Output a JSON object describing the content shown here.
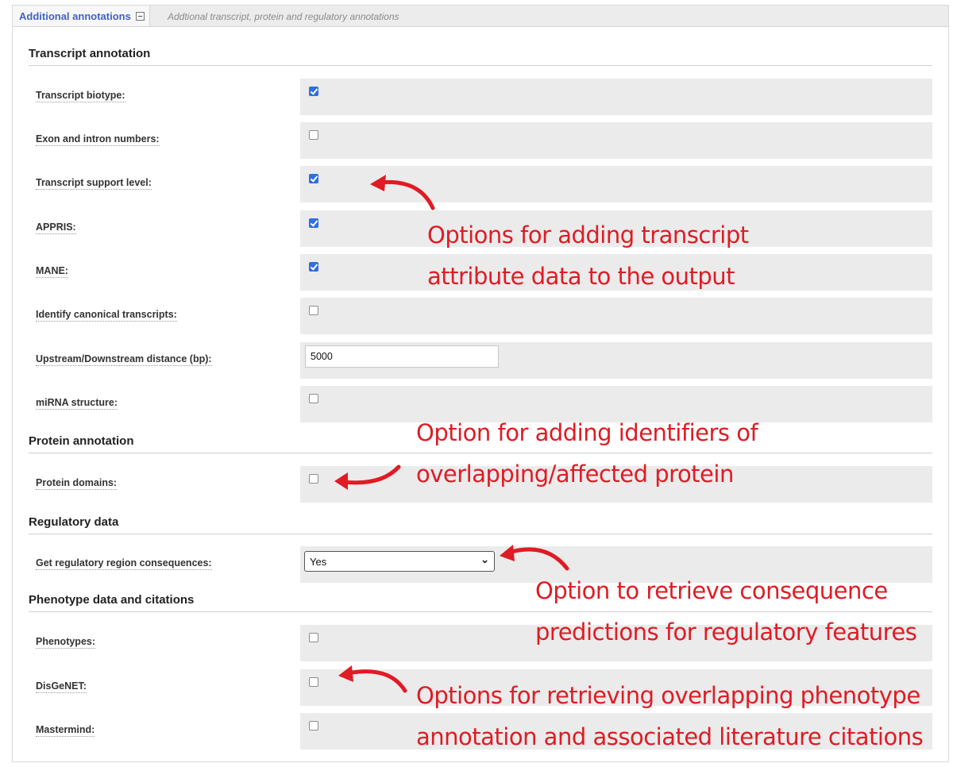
{
  "tab": {
    "title": "Additional annotations",
    "description": "Addtional transcript, protein and regulatory annotations"
  },
  "sections": {
    "transcript": "Transcript annotation",
    "protein": "Protein annotation",
    "regulatory": "Regulatory data",
    "phenotype": "Phenotype data and citations"
  },
  "fields": {
    "transcript_biotype": {
      "label": "Transcript biotype:",
      "checked": true
    },
    "exon_intron_numbers": {
      "label": "Exon and intron numbers:",
      "checked": false
    },
    "transcript_support_level": {
      "label": "Transcript support level:",
      "checked": true
    },
    "appris": {
      "label": "APPRIS:",
      "checked": true
    },
    "mane": {
      "label": "MANE:",
      "checked": true
    },
    "canonical": {
      "label": "Identify canonical transcripts:",
      "checked": false
    },
    "distance": {
      "label": "Upstream/Downstream distance (bp):",
      "value": "5000"
    },
    "mirna": {
      "label": "miRNA structure:",
      "checked": false
    },
    "protein_domains": {
      "label": "Protein domains:",
      "checked": false
    },
    "regulatory": {
      "label": "Get regulatory region consequences:",
      "value": "Yes"
    },
    "phenotypes": {
      "label": "Phenotypes:",
      "checked": false
    },
    "disgenet": {
      "label": "DisGeNET:",
      "checked": false
    },
    "mastermind": {
      "label": "Mastermind:",
      "checked": false
    }
  },
  "annotations": {
    "transcript_note": [
      "Options for adding transcript",
      "attribute data to the output"
    ],
    "protein_note": [
      "Option for adding identifiers of",
      "overlapping/affected protein"
    ],
    "regulatory_note": [
      "Option to retrieve consequence",
      "predictions for regulatory features"
    ],
    "phenotype_note": [
      "Options for retrieving overlapping phenotype",
      "annotation and associated literature citations"
    ]
  },
  "colors": {
    "annotation_red": "#e01b24",
    "tab_title_blue": "#3e63c4",
    "checkbox_blue": "#2f6fe0"
  },
  "icons": [
    "collapse-icon",
    "chevron-down-icon",
    "arrow-icon"
  ]
}
